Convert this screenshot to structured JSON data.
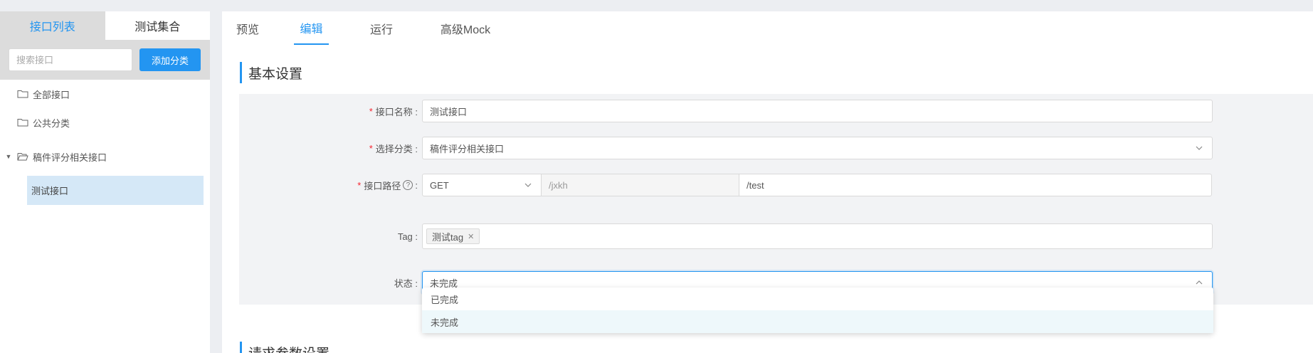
{
  "sidebar": {
    "tabs": [
      {
        "label": "接口列表",
        "active": true
      },
      {
        "label": "测试集合",
        "active": false
      }
    ],
    "search_placeholder": "搜索接口",
    "add_category_label": "添加分类",
    "tree": [
      {
        "label": "全部接口",
        "icon": "folder-icon"
      },
      {
        "label": "公共分类",
        "icon": "folder-icon"
      },
      {
        "label": "稿件评分相关接口",
        "icon": "folder-open-icon",
        "expanded": true
      }
    ],
    "selected_leaf": "测试接口"
  },
  "tabs": [
    {
      "label": "预览",
      "active": false
    },
    {
      "label": "编辑",
      "active": true
    },
    {
      "label": "运行",
      "active": false
    },
    {
      "label": "高级Mock",
      "active": false
    }
  ],
  "basic": {
    "title": "基本设置",
    "name_label": "接口名称 :",
    "name_value": "测试接口",
    "category_label": "选择分类 :",
    "category_value": "稿件评分相关接口",
    "path_label": "接口路径",
    "path_label_colon": ":",
    "method": "GET",
    "base_path": "/jxkh",
    "path_value": "/test",
    "tag_label": "Tag :",
    "tags": [
      "测试tag"
    ],
    "status_label": "状态 :",
    "status_value": "未完成",
    "status_options": [
      {
        "label": "已完成",
        "selected": false
      },
      {
        "label": "未完成",
        "selected": true
      }
    ]
  },
  "params_title": "请求参数设置",
  "colors": {
    "accent": "#2395f1",
    "required": "#f5222d"
  }
}
